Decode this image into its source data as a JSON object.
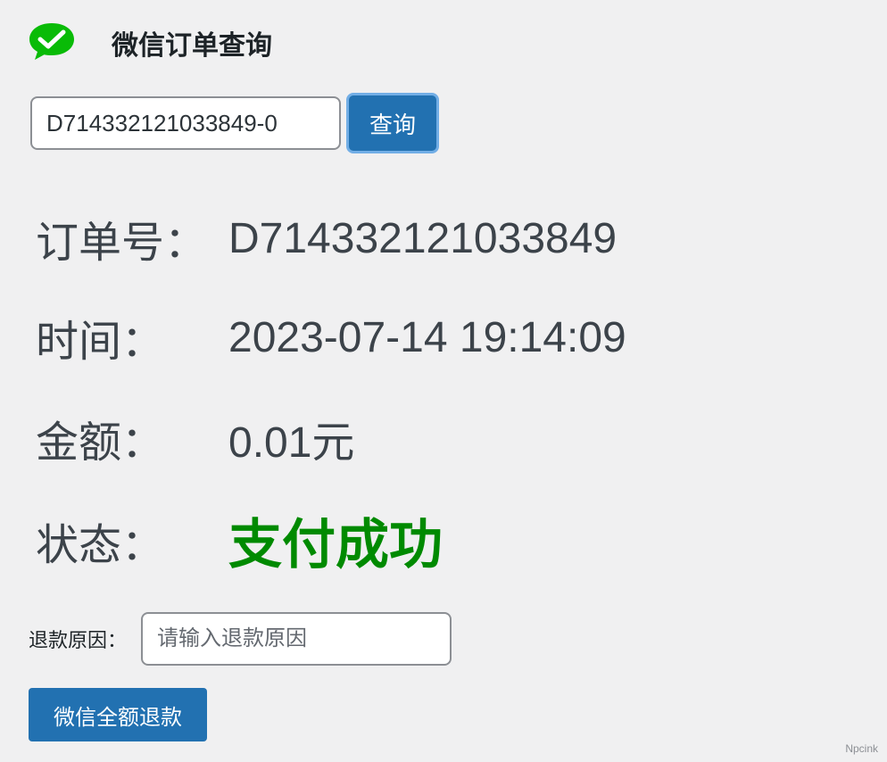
{
  "header": {
    "logo_icon": "wechat-pay-icon",
    "title": "微信订单查询"
  },
  "search": {
    "order_value": "D714332121033849-0",
    "query_label": "查询"
  },
  "order": {
    "order_no_label": "订单号：",
    "order_no_value": "D714332121033849",
    "time_label": "时间：",
    "time_value": "2023-07-14 19:14:09",
    "amount_label": "金额：",
    "amount_value": "0.01元",
    "status_label": "状态：",
    "status_value": "支付成功",
    "status_color": "#008a00"
  },
  "refund": {
    "reason_label": "退款原因：",
    "reason_placeholder": "请输入退款原因",
    "button_label": "微信全额退款"
  },
  "colors": {
    "primary_button": "#2271b1",
    "logo_green": "#09bb07"
  },
  "watermark": "Npcink"
}
